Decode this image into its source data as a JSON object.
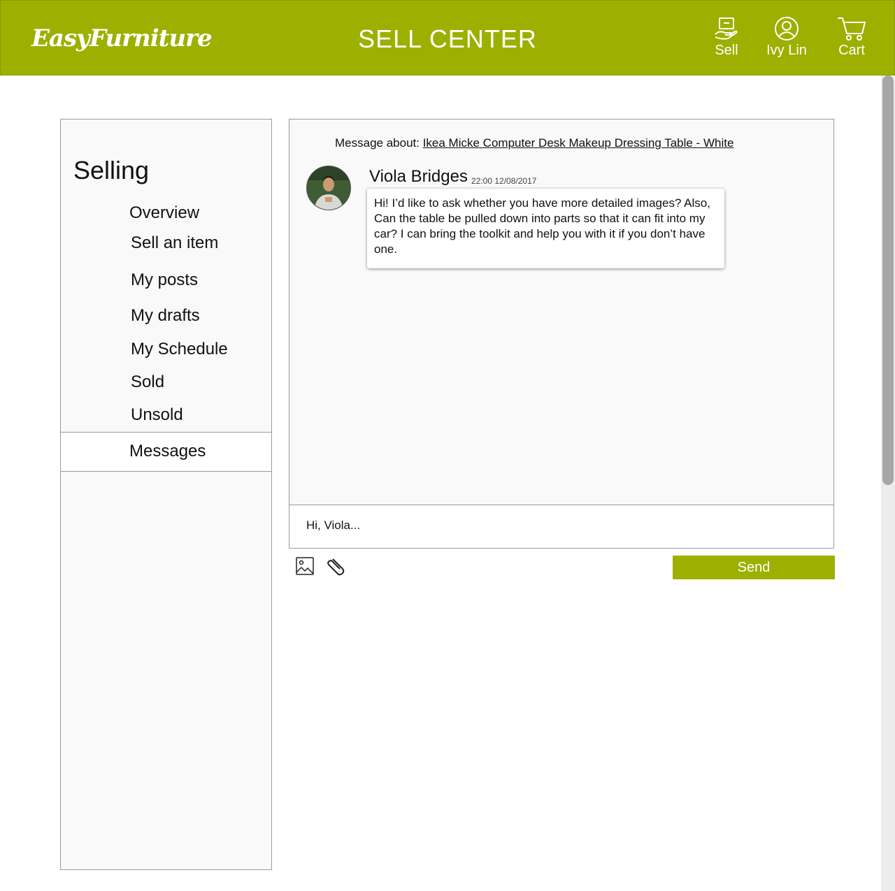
{
  "header": {
    "logo": "EasyFurniture",
    "title": "SELL CENTER",
    "sell_label": "Sell",
    "user_label": "Ivy Lin",
    "cart_label": "Cart"
  },
  "sidebar": {
    "title": "Selling",
    "items": [
      "Overview",
      "Sell an item",
      "My posts",
      "My drafts",
      "My Schedule",
      "Sold",
      "Unsold"
    ],
    "active_item": "Messages"
  },
  "conversation": {
    "about_prefix": "Message about:",
    "about_link": "Ikea Micke Computer Desk  Makeup Dressing Table - White",
    "sender": "Viola Bridges",
    "timestamp": "22:00 12/08/2017",
    "message": "Hi! I’d like to ask whether you have more detailed images? Also, Can the table be pulled down into parts so that it can fit into my car? I can bring the toolkit and help you with it if you don’t have one."
  },
  "reply": {
    "value": "Hi, Viola...",
    "send_label": "Send"
  },
  "icons": {
    "sell": "sell-icon",
    "user": "user-icon",
    "cart": "cart-icon",
    "image": "image-icon",
    "attach": "paperclip-icon"
  },
  "colors": {
    "brand": "#9db000",
    "panel_bg": "#f9f9f9"
  }
}
